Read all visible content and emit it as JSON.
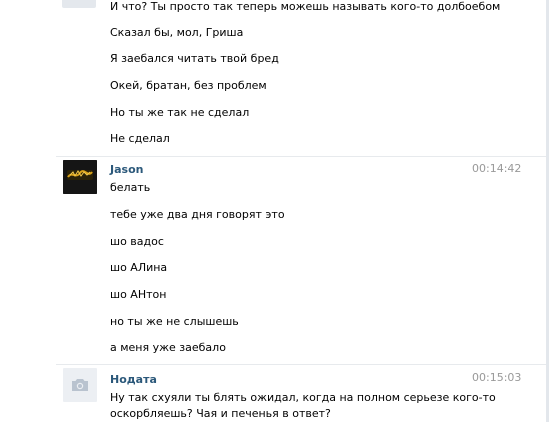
{
  "conversation": {
    "group_prev": {
      "messages": [
        "И что? Ты просто так теперь можешь называть кого-то долбоебом",
        "Сказал бы, мол, Гриша",
        "Я заебался читать твой бред",
        "Окей, братан, без проблем",
        "Но ты же так не сделал",
        "Не сделал"
      ]
    },
    "group_jason": {
      "author": "Jason",
      "time": "00:14:42",
      "avatar_icon": "user-photo-icon",
      "messages": [
        "белать",
        "тебе уже два дня говорят это",
        "шо вадос",
        "шо АЛина",
        "шо АНтон",
        "но ты же не слышешь",
        "а меня уже заебало"
      ]
    },
    "group_nodata": {
      "author": "Нодата",
      "time": "00:15:03",
      "avatar_icon": "camera-icon",
      "messages": [
        "Ну так схуяли ты блять ожидал, когда на полном серьезе кого-то",
        "оскорбляешь? Чая и печенья в ответ?"
      ]
    }
  },
  "colors": {
    "author_link": "#2b587a",
    "timestamp": "#999999",
    "separator": "#e7eaed",
    "placeholder_avatar_bg": "#eceff3",
    "camera_icon": "#b9c3cf"
  }
}
